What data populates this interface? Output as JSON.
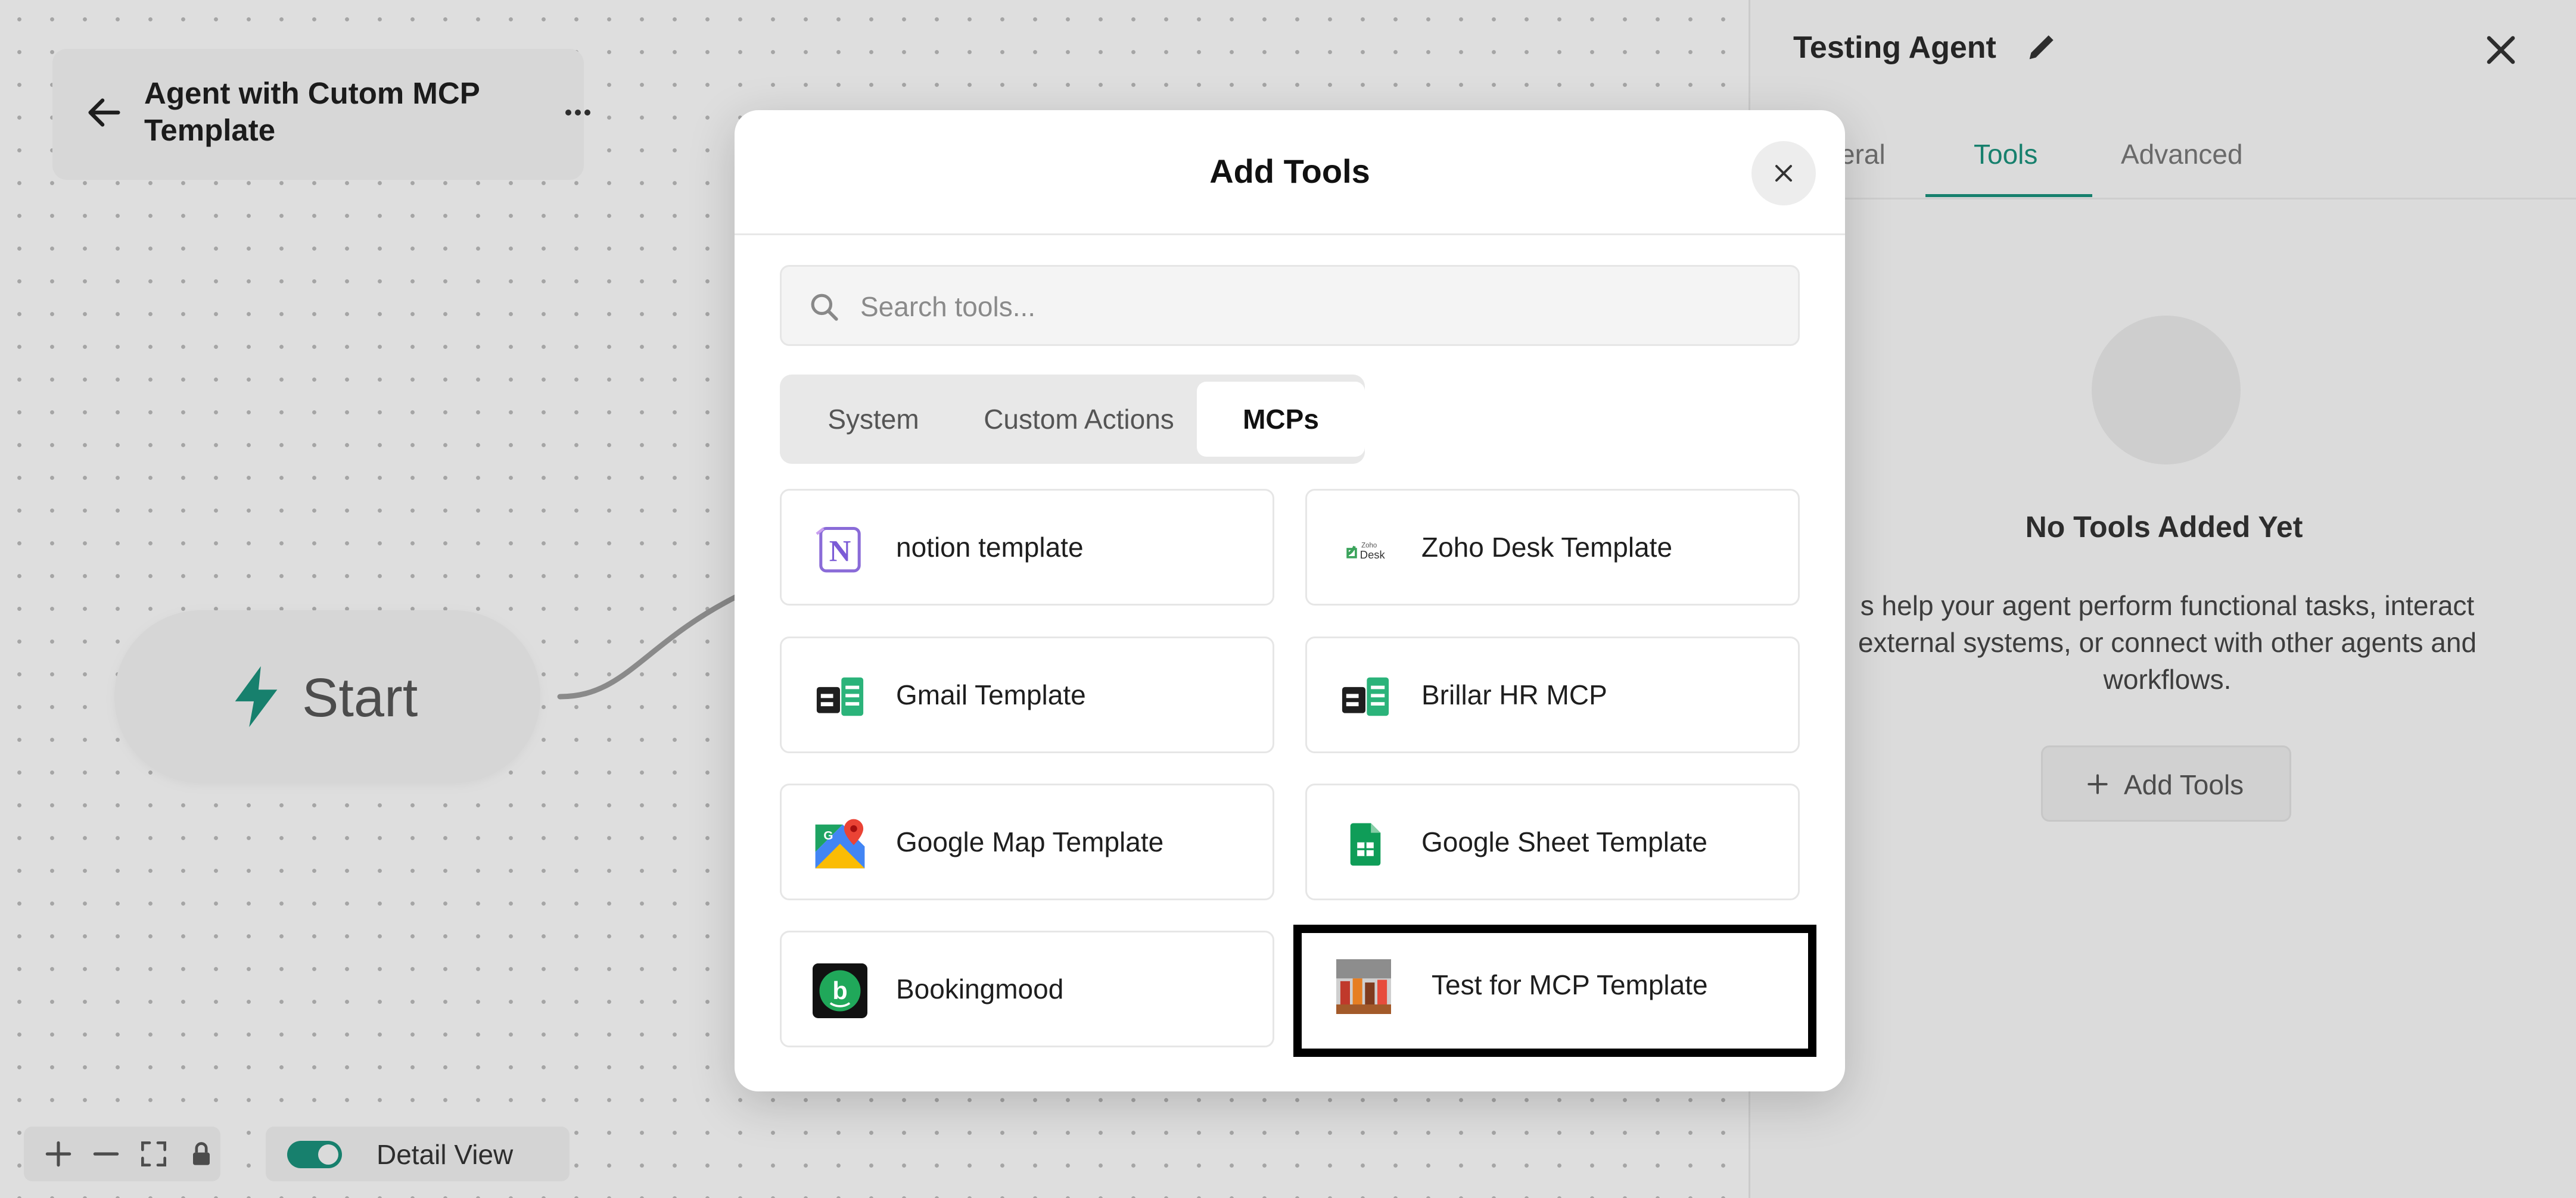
{
  "canvas": {
    "agent_title": "Agent with Cutom MCP Template",
    "start_label": "Start",
    "detail_view_label": "Detail View"
  },
  "panel": {
    "title": "Testing Agent",
    "tabs": [
      "eral",
      "Tools",
      "Advanced"
    ],
    "active_tab": "Tools",
    "empty_title": "No Tools Added Yet",
    "empty_desc": "s help your agent perform functional tasks, interact\nexternal systems, or connect with other agents and\nworkflows.",
    "add_tools_label": "Add Tools"
  },
  "modal": {
    "title": "Add Tools",
    "search_placeholder": "Search tools...",
    "tabs": [
      "System",
      "Custom Actions",
      "MCPs"
    ],
    "active_tab": "MCPs",
    "tools": [
      {
        "name": "notion template",
        "icon": "notion-icon"
      },
      {
        "name": "Zoho Desk Template",
        "icon": "zoho-desk-icon"
      },
      {
        "name": "Gmail Template",
        "icon": "template-doc-icon"
      },
      {
        "name": "Brillar HR MCP",
        "icon": "template-doc-icon"
      },
      {
        "name": "Google Map Template",
        "icon": "google-maps-icon"
      },
      {
        "name": "Google Sheet Template",
        "icon": "google-sheets-icon"
      },
      {
        "name": "Bookingmood",
        "icon": "bookingmood-icon"
      },
      {
        "name": "Test for MCP Template",
        "icon": "photo-thumbnail-icon"
      }
    ]
  },
  "colors": {
    "accent": "#1a8f7a",
    "highlight_border": "#000000"
  }
}
